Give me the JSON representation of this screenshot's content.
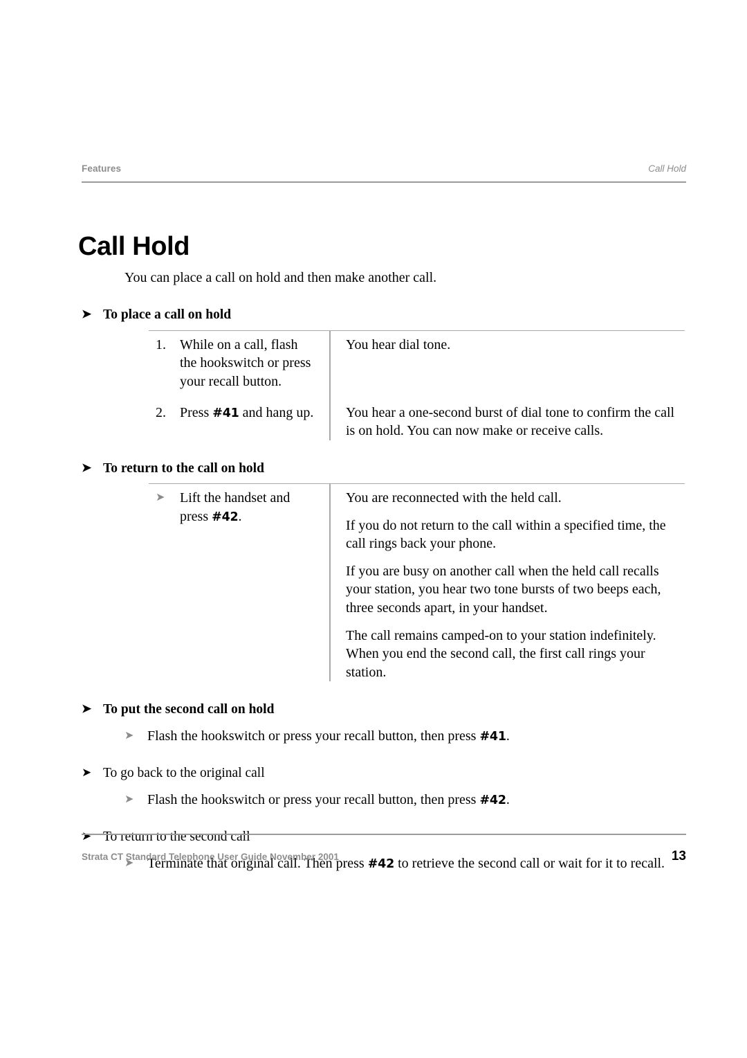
{
  "header": {
    "left": "Features",
    "right": "Call Hold"
  },
  "title": "Call Hold",
  "intro": "You can place a call on hold and then make another call.",
  "arrows": {
    "black": "➤",
    "grey": "➤"
  },
  "sections": [
    {
      "heading": "To place a call on hold",
      "rows": [
        {
          "marker": "1.",
          "action_pre": "While on a call, flash the hookswitch or press your recall button.",
          "action_code": "",
          "action_post": "",
          "results": [
            "You hear dial tone."
          ]
        },
        {
          "marker": "2.",
          "action_pre": "Press ",
          "action_code": "#41",
          "action_post": " and hang up.",
          "results": [
            "You hear a one-second burst of dial tone to confirm the call is on hold. You can now make or receive calls."
          ]
        }
      ]
    },
    {
      "heading": "To return to the call on hold",
      "rows": [
        {
          "marker": "➤",
          "action_pre": "Lift the handset and press ",
          "action_code": "#42",
          "action_post": ".",
          "results": [
            "You are reconnected with the held call.",
            "If you do not return to the call within a specified time, the call rings back your phone.",
            "If you are busy on another call when the held call recalls your station, you hear two tone bursts of two beeps each, three seconds apart, in your handset.",
            "The call remains camped-on to your station indefinitely. When you end the second call, the first call rings your station."
          ]
        }
      ]
    }
  ],
  "simple_sections": [
    {
      "heading": "To put the second call on hold",
      "bold": true,
      "bullet_pre": "Flash the hookswitch or press your recall button, then press ",
      "bullet_code": "#41",
      "bullet_post": "."
    },
    {
      "heading": "To go back to the original call",
      "bold": false,
      "bullet_pre": "Flash the hookswitch or press your recall button, then press ",
      "bullet_code": "#42",
      "bullet_post": "."
    },
    {
      "heading": "To return to the second call",
      "bold": false,
      "bullet_pre": "Terminate that original call. Then press ",
      "bullet_code": "#42",
      "bullet_post": " to retrieve the second call or wait for it to recall."
    }
  ],
  "footer": {
    "left": "Strata CT Standard Telephone User Guide  November 2001",
    "page": "13"
  }
}
